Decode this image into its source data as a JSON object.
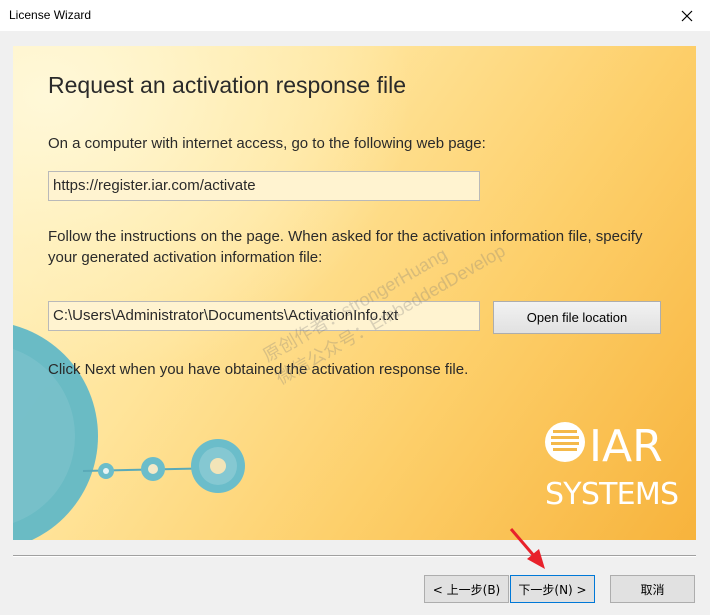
{
  "window": {
    "title": "License Wizard"
  },
  "page": {
    "heading": "Request an activation response file",
    "instruction_1": "On a computer with internet access, go to the following web page:",
    "url": "https://register.iar.com/activate",
    "instruction_2": "Follow the instructions on the page. When asked for the activation information file, specify your generated activation information file:",
    "file_path": "C:\\Users\\Administrator\\Documents\\ActivationInfo.txt",
    "open_location_label": "Open file location",
    "instruction_3": "Click Next when you have obtained the activation response file."
  },
  "logo": {
    "top": "IAR",
    "bottom": "SYSTEMS"
  },
  "watermark": {
    "line1": "原创作者：strongerHuang",
    "line2": "微信公众号：EmbeddedDevelop"
  },
  "footer": {
    "back_label": "< 上一步(B)",
    "next_label": "下一步(N) >",
    "cancel_label": "取消"
  },
  "colors": {
    "panel_gradient_start": "#fff3c4",
    "panel_gradient_end": "#f7b33c",
    "accent_circle": "#5fb7c7",
    "arrow_red": "#e8212b"
  }
}
